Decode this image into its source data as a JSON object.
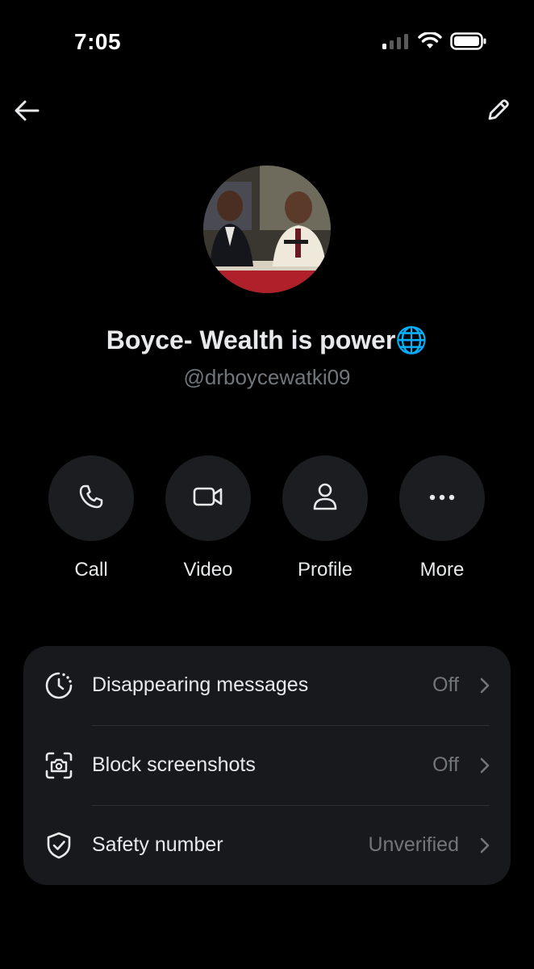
{
  "status_bar": {
    "time": "7:05"
  },
  "profile": {
    "display_name": "Boyce- Wealth is power🌐",
    "handle": "@drboycewatki09"
  },
  "actions": [
    {
      "label": "Call",
      "icon": "phone-icon"
    },
    {
      "label": "Video",
      "icon": "video-camera-icon"
    },
    {
      "label": "Profile",
      "icon": "person-icon"
    },
    {
      "label": "More",
      "icon": "more-horizontal-icon"
    }
  ],
  "settings": [
    {
      "label": "Disappearing messages",
      "value": "Off",
      "icon": "timer-icon"
    },
    {
      "label": "Block screenshots",
      "value": "Off",
      "icon": "screenshot-camera-icon"
    },
    {
      "label": "Safety number",
      "value": "Unverified",
      "icon": "shield-check-icon"
    }
  ],
  "colors": {
    "background": "#000000",
    "card": "#18191c",
    "action_circle": "#1c1d20",
    "primary_text": "#e7e9ea",
    "secondary_text": "#71767b"
  }
}
